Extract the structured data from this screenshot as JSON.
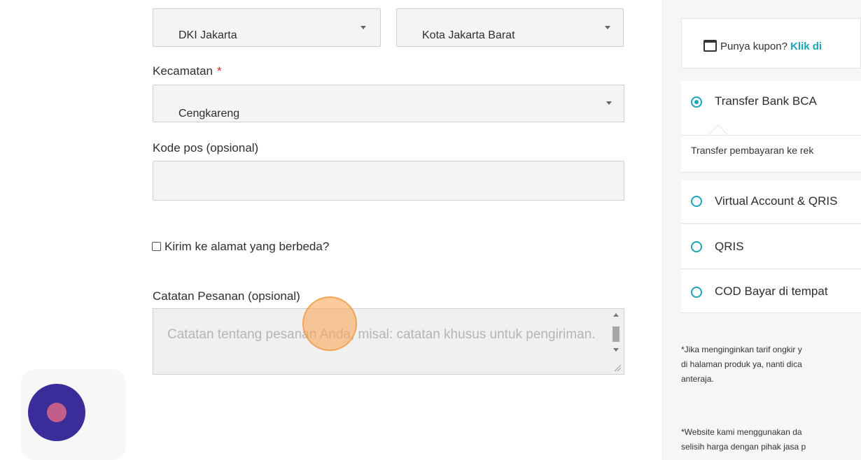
{
  "form": {
    "province": {
      "value": "DKI Jakarta"
    },
    "city": {
      "value": "Kota Jakarta Barat"
    },
    "district": {
      "label": "Kecamatan",
      "required_mark": "*",
      "value": "Cengkareng"
    },
    "postcode": {
      "label": "Kode pos (opsional)",
      "value": ""
    },
    "ship_different": {
      "label": "Kirim ke alamat yang berbeda?",
      "checked": false
    },
    "order_notes": {
      "label": "Catatan Pesanan (opsional)",
      "placeholder": "Catatan tentang pesanan Anda, misal: catatan khusus untuk pengiriman."
    }
  },
  "sidebar": {
    "coupon": {
      "text": "Punya kupon?",
      "link": "Klik di"
    },
    "payment_methods": [
      {
        "label": "Transfer Bank BCA",
        "selected": true
      },
      {
        "label": "Virtual Account & QRIS",
        "selected": false
      },
      {
        "label": "QRIS",
        "selected": false
      },
      {
        "label": "COD Bayar di tempat",
        "selected": false
      }
    ],
    "bca_description": "Transfer pembayaran ke rek",
    "notes": [
      [
        "*Jika menginginkan tarif ongkir y",
        "di halaman produk ya, nanti dica",
        "anteraja."
      ],
      [
        "*Website kami menggunakan da",
        "selisih harga dengan pihak jasa p"
      ]
    ]
  },
  "colors": {
    "accent": "#1aa4b8",
    "required": "#d9262e",
    "fab": "#3a2d9a",
    "fab_dot": "#c35e8a"
  }
}
